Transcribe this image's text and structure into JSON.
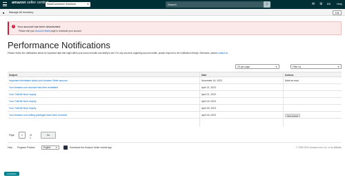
{
  "header": {
    "logo_brand": "amazon",
    "logo_product": "seller central",
    "store": "NovaCommerce Solutions",
    "search_placeholder": "Search",
    "language": "EN",
    "help": "Help"
  },
  "subnav": {
    "manage_link": "Manage All Inventory",
    "edit_label": "Edit"
  },
  "alert": {
    "title": "Your account has been deactivated",
    "text_prefix": "Please visit your",
    "link_text": "Account Health",
    "text_suffix": "page to reactivate your account"
  },
  "page": {
    "title": "Performance Notifications",
    "intro_text": "Please review the notifications below for important data that might affect your account health and ability to sell. For any concerns regarding account health, please respond to the notification directly. Otherwise, please",
    "intro_link": "contact us",
    "intro_end": "."
  },
  "controls": {
    "per_page": "25 per page",
    "filter_by": "Filter by"
  },
  "table": {
    "headers": [
      "Subject",
      "Date",
      "Actions"
    ],
    "rows": [
      {
        "subject": "Important information about your Amazon Seller account",
        "date": "November 16, 2023",
        "action": "Mark as read"
      },
      {
        "subject": "Your Amazon.com account has been reinstated",
        "date": "April 21, 2023",
        "action": ""
      },
      {
        "subject": "Your 'Call Me Now' Inquiry",
        "date": "April 21, 2023",
        "action": ""
      },
      {
        "subject": "Your 'Call Me Now' Inquiry",
        "date": "April 18, 2023",
        "action": ""
      },
      {
        "subject": "Your 'Call Me Now' Inquiry",
        "date": "April 18, 2023",
        "action": ""
      },
      {
        "subject": "Your Amazon.com selling privileges have been removed",
        "date": "April 18, 2023",
        "action": "View request"
      }
    ]
  },
  "pager": {
    "page_label": "Page",
    "page_value": "1",
    "of_label": "of 1",
    "go_label": "Go"
  },
  "footer": {
    "help": "Help",
    "policies": "Program Policies",
    "language": "English",
    "app_text": "Download the Amazon Seller mobile app",
    "copyright": "© 1999-2023, Amazon.com, Inc. or its affiliates"
  },
  "bottom_pill": "Feedback"
}
